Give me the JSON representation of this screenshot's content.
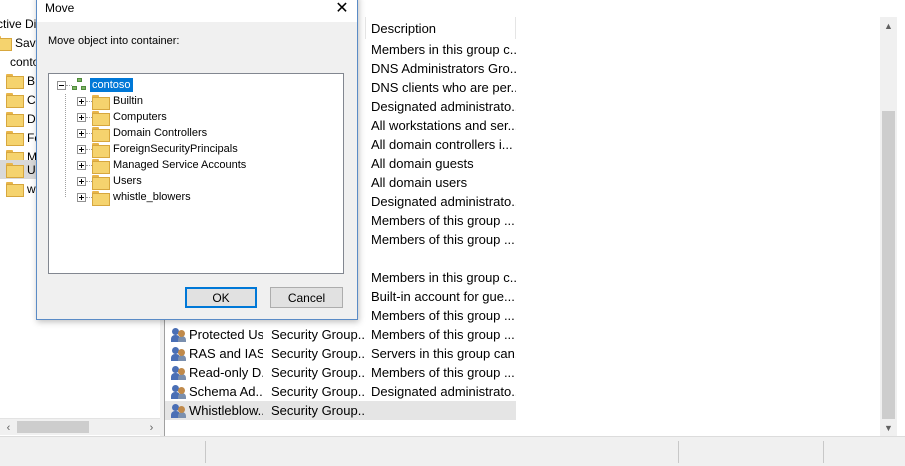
{
  "left_tree": {
    "items": [
      {
        "label": "ctive Di"
      },
      {
        "label": "Saved"
      },
      {
        "label": "conto"
      },
      {
        "label": "B"
      },
      {
        "label": "C"
      },
      {
        "label": "D"
      },
      {
        "label": "Fo"
      },
      {
        "label": "M"
      },
      {
        "label": "U"
      },
      {
        "label": "w"
      }
    ]
  },
  "list": {
    "columns": {
      "name": "",
      "type": "",
      "description": "Description"
    },
    "rows": [
      {
        "name": "",
        "type": "",
        "description": "Members in this group c..."
      },
      {
        "name": "",
        "type": "",
        "description": "DNS Administrators Gro..."
      },
      {
        "name": "",
        "type": "",
        "description": "DNS clients who are per..."
      },
      {
        "name": "",
        "type": "",
        "description": "Designated administrato..."
      },
      {
        "name": "",
        "type": "",
        "description": "All workstations and ser..."
      },
      {
        "name": "",
        "type": "",
        "description": "All domain controllers i..."
      },
      {
        "name": "",
        "type": "",
        "description": "All domain guests"
      },
      {
        "name": "",
        "type": "",
        "description": "All domain users"
      },
      {
        "name": "",
        "type": "",
        "description": "Designated administrato..."
      },
      {
        "name": "",
        "type": "",
        "description": "Members of this group ..."
      },
      {
        "name": "",
        "type": "",
        "description": "Members of this group ..."
      },
      {
        "name": "",
        "type": "",
        "description": ""
      },
      {
        "name": "",
        "type": "",
        "description": "Members in this group c..."
      },
      {
        "name": "",
        "type": "",
        "description": "Built-in account for gue..."
      },
      {
        "name": "",
        "type": "",
        "description": "Members of this group ..."
      },
      {
        "name": "Protected Us...",
        "type": "Security Group...",
        "description": "Members of this group ..."
      },
      {
        "name": "RAS and IAS ...",
        "type": "Security Group...",
        "description": "Servers in this group can..."
      },
      {
        "name": "Read-only D...",
        "type": "Security Group...",
        "description": "Members of this group ..."
      },
      {
        "name": "Schema Ad...",
        "type": "Security Group...",
        "description": "Designated administrato..."
      },
      {
        "name": "Whistleblow...",
        "type": "Security Group...",
        "description": ""
      }
    ]
  },
  "dialog": {
    "title": "Move",
    "close_glyph": "✕",
    "prompt": "Move object into container:",
    "tree": {
      "root": "contoso",
      "children": [
        {
          "label": "Builtin"
        },
        {
          "label": "Computers"
        },
        {
          "label": "Domain Controllers"
        },
        {
          "label": "ForeignSecurityPrincipals"
        },
        {
          "label": "Managed Service Accounts"
        },
        {
          "label": "Users"
        },
        {
          "label": "whistle_blowers"
        }
      ]
    },
    "ok_label": "OK",
    "cancel_label": "Cancel"
  },
  "scroll": {
    "left_arrow": "‹",
    "right_arrow": "›",
    "up_arrow": "▲",
    "down_arrow": "▼"
  }
}
